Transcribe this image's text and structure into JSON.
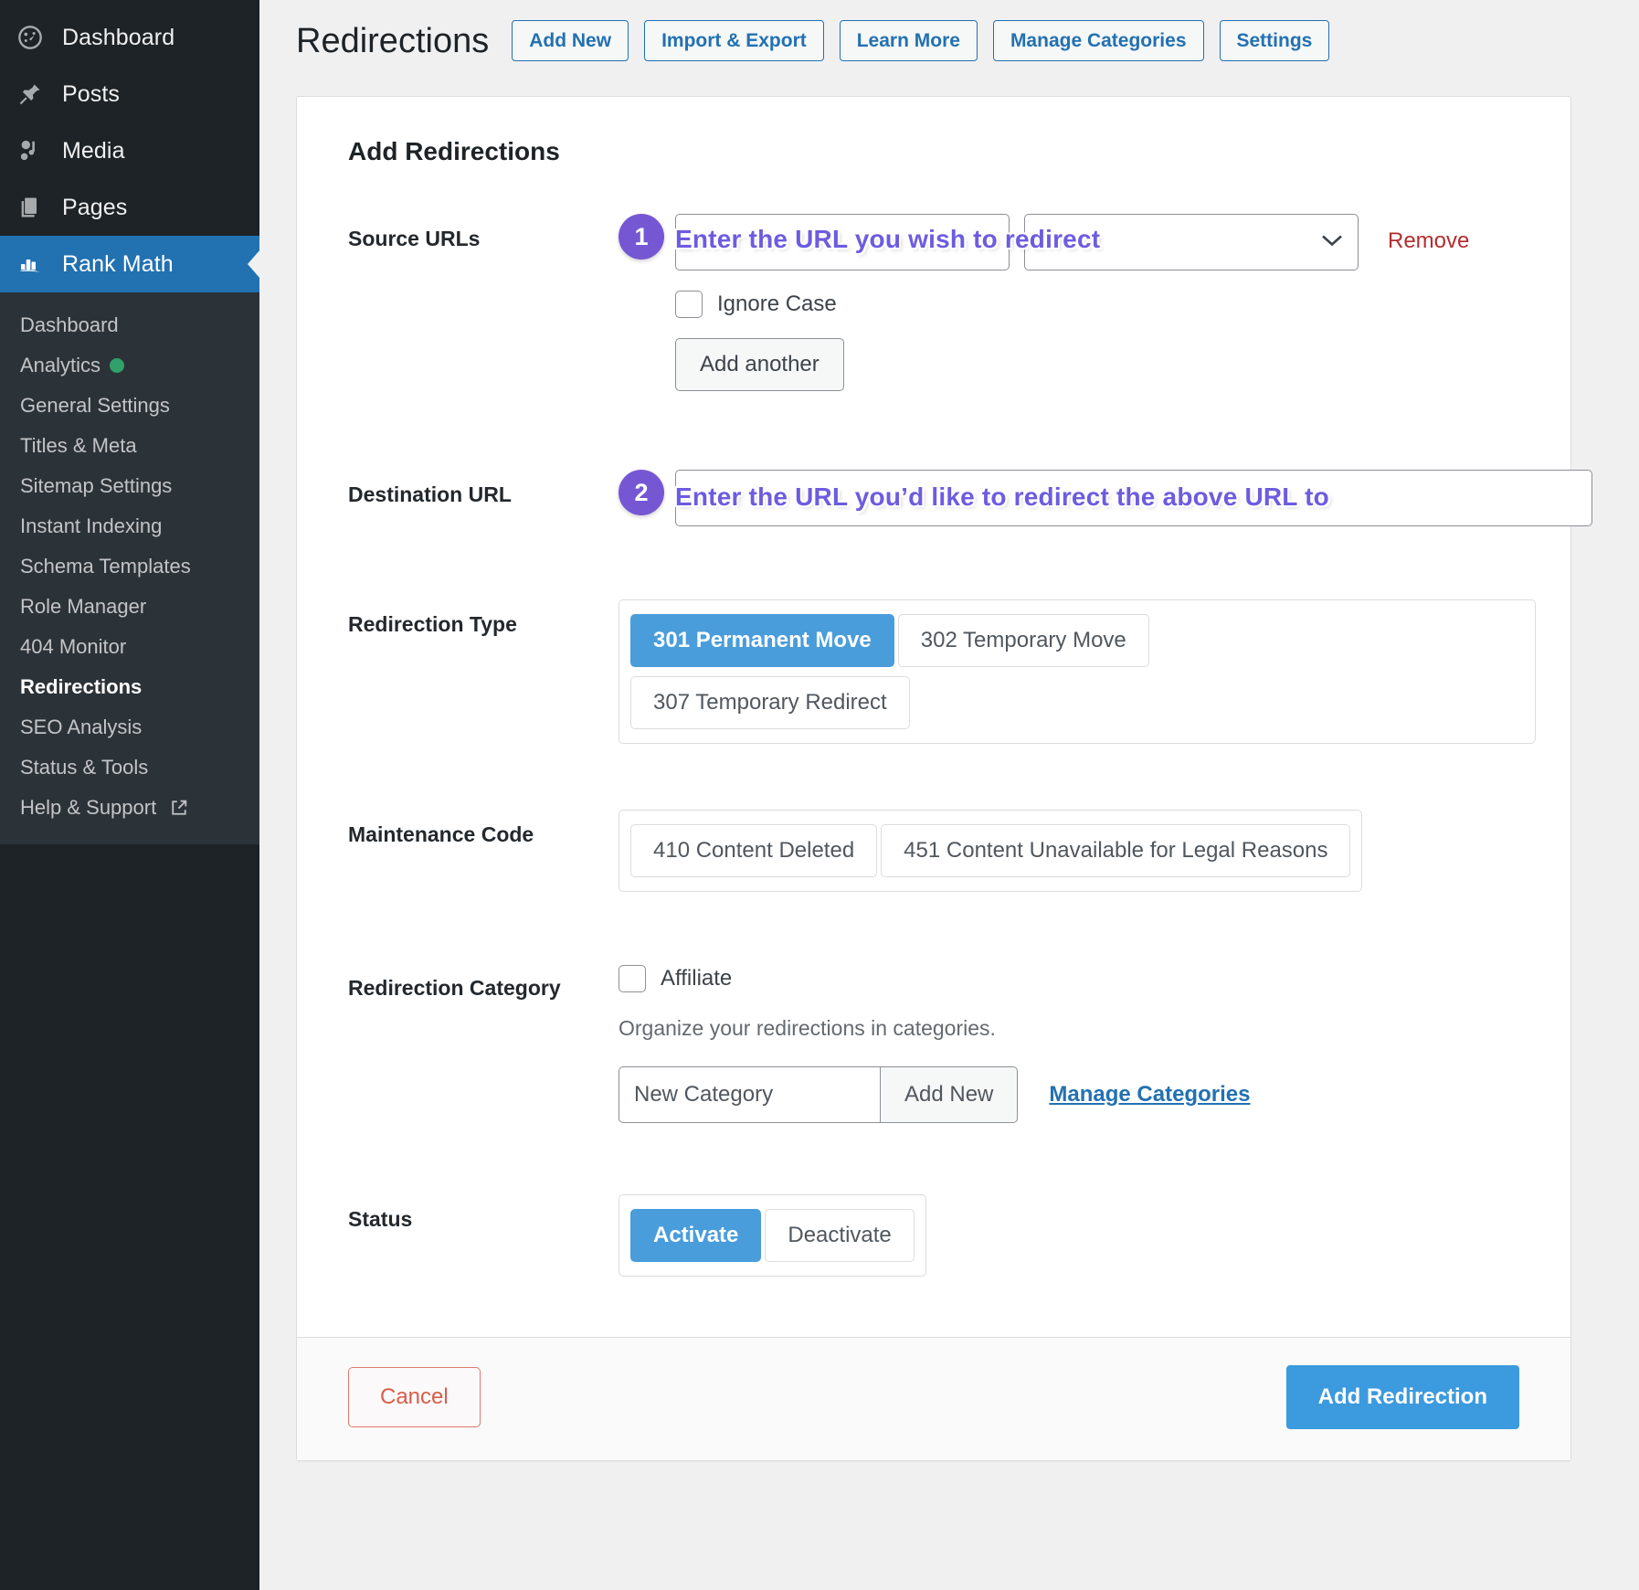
{
  "sidebar": {
    "top_items": [
      {
        "label": "Dashboard",
        "icon": "dashboard-icon",
        "active": false
      },
      {
        "label": "Posts",
        "icon": "pin-icon",
        "active": false
      },
      {
        "label": "Media",
        "icon": "media-icon",
        "active": false
      },
      {
        "label": "Pages",
        "icon": "pages-icon",
        "active": false
      },
      {
        "label": "Rank Math",
        "icon": "rank-math-icon",
        "active": true
      }
    ],
    "submenu": [
      {
        "label": "Dashboard",
        "current": false,
        "badge": null,
        "external": false
      },
      {
        "label": "Analytics",
        "current": false,
        "badge": "green-dot",
        "external": false
      },
      {
        "label": "General Settings",
        "current": false,
        "badge": null,
        "external": false
      },
      {
        "label": "Titles & Meta",
        "current": false,
        "badge": null,
        "external": false
      },
      {
        "label": "Sitemap Settings",
        "current": false,
        "badge": null,
        "external": false
      },
      {
        "label": "Instant Indexing",
        "current": false,
        "badge": null,
        "external": false
      },
      {
        "label": "Schema Templates",
        "current": false,
        "badge": null,
        "external": false
      },
      {
        "label": "Role Manager",
        "current": false,
        "badge": null,
        "external": false
      },
      {
        "label": "404 Monitor",
        "current": false,
        "badge": null,
        "external": false
      },
      {
        "label": "Redirections",
        "current": true,
        "badge": null,
        "external": false
      },
      {
        "label": "SEO Analysis",
        "current": false,
        "badge": null,
        "external": false
      },
      {
        "label": "Status & Tools",
        "current": false,
        "badge": null,
        "external": false
      },
      {
        "label": "Help & Support",
        "current": false,
        "badge": null,
        "external": true
      }
    ]
  },
  "header": {
    "title": "Redirections",
    "buttons": [
      "Add New",
      "Import & Export",
      "Learn More",
      "Manage Categories",
      "Settings"
    ]
  },
  "panel": {
    "title": "Add Redirections",
    "source_urls": {
      "label": "Source URLs",
      "badge": "1",
      "annotation": "Enter the URL you wish to redirect",
      "url_placeholder": "",
      "url_value": "",
      "comparison_value": "",
      "remove_label": "Remove",
      "ignore_case_label": "Ignore Case",
      "ignore_case_checked": false,
      "add_another_label": "Add another"
    },
    "destination_url": {
      "label": "Destination URL",
      "badge": "2",
      "annotation": "Enter the URL you’d like to redirect the above URL to",
      "value": "",
      "placeholder": ""
    },
    "redirection_type": {
      "label": "Redirection Type",
      "options": [
        {
          "label": "301 Permanent Move",
          "selected": true
        },
        {
          "label": "302 Temporary Move",
          "selected": false
        },
        {
          "label": "307 Temporary Redirect",
          "selected": false
        }
      ]
    },
    "maintenance_code": {
      "label": "Maintenance Code",
      "options": [
        {
          "label": "410 Content Deleted",
          "selected": false
        },
        {
          "label": "451 Content Unavailable for Legal Reasons",
          "selected": false
        }
      ]
    },
    "redirection_category": {
      "label": "Redirection Category",
      "affiliate_label": "Affiliate",
      "affiliate_checked": false,
      "helper_text": "Organize your redirections in categories.",
      "new_category_placeholder": "New Category",
      "new_category_value": "",
      "add_new_label": "Add New",
      "manage_categories_label": "Manage Categories"
    },
    "status": {
      "label": "Status",
      "options": [
        {
          "label": "Activate",
          "selected": true
        },
        {
          "label": "Deactivate",
          "selected": false
        }
      ]
    },
    "footer": {
      "cancel_label": "Cancel",
      "submit_label": "Add Redirection"
    }
  },
  "colors": {
    "wp_blue": "#2271b1",
    "accent_blue": "#3c9ade",
    "annotation_purple": "#6c5ce0",
    "badge_purple": "#7557d4",
    "remove_red": "#b32d2e",
    "cancel_red": "#d95c4a",
    "analytics_green": "#31a06a"
  }
}
